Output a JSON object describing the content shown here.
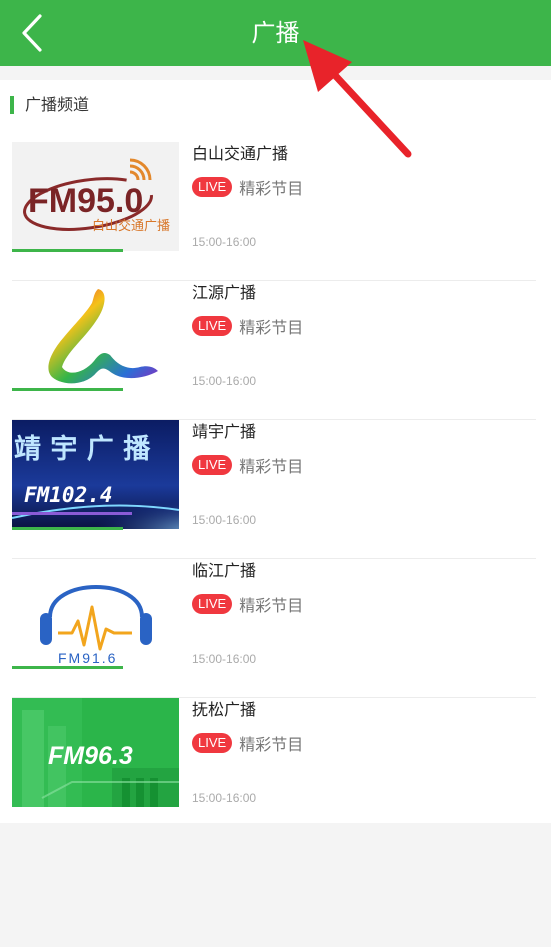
{
  "header": {
    "title": "广播",
    "back_icon": "chevron-left-icon"
  },
  "section": {
    "title": "广播频道"
  },
  "stations": [
    {
      "name": "白山交通广播",
      "live": "LIVE",
      "program": "精彩节目",
      "time": "15:00-16:00",
      "logo_text": "FM95.0",
      "logo_sub": "白山交通广播"
    },
    {
      "name": "江源广播",
      "live": "LIVE",
      "program": "精彩节目",
      "time": "15:00-16:00"
    },
    {
      "name": "靖宇广播",
      "live": "LIVE",
      "program": "精彩节目",
      "time": "15:00-16:00",
      "logo_text": "FM102.4",
      "logo_sub": "靖 宇 广 播"
    },
    {
      "name": "临江广播",
      "live": "LIVE",
      "program": "精彩节目",
      "time": "15:00-16:00",
      "logo_text": "FM91.6"
    },
    {
      "name": "抚松广播",
      "live": "LIVE",
      "program": "精彩节目",
      "time": "15:00-16:00",
      "logo_text": "FM96.3"
    }
  ],
  "colors": {
    "brand_green": "#3db54a",
    "live_red": "#f0383f",
    "annotation_arrow": "#e8232a"
  }
}
